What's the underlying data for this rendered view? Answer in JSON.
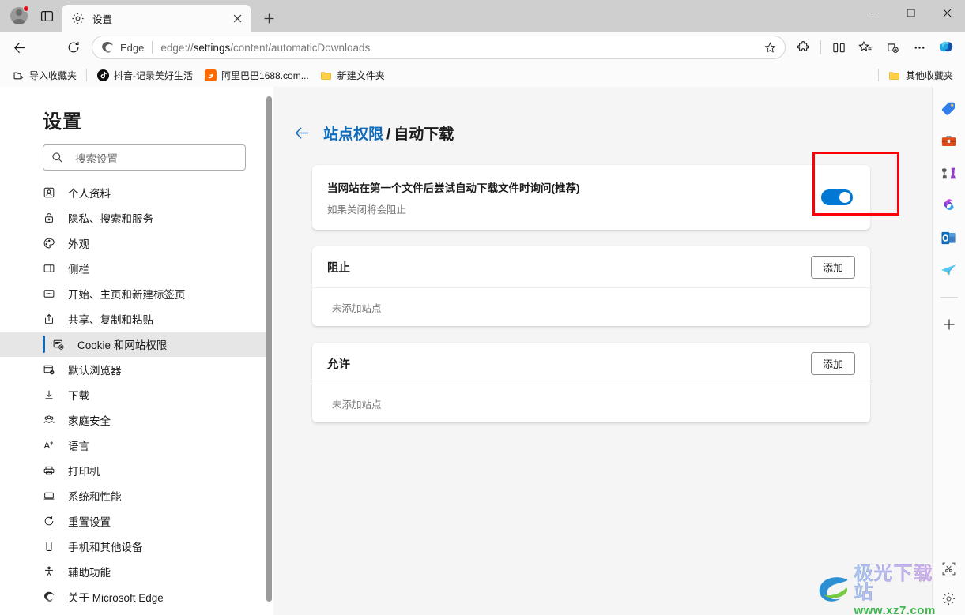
{
  "window": {
    "minimize_label": "—",
    "maximize_label": "□",
    "close_label": "✕"
  },
  "tabstrip": {
    "profile_name": "profile-avatar",
    "tab_actions_label": "tab-actions",
    "active_tab_title": "设置",
    "close_tab_label": "✕",
    "new_tab_label": "+"
  },
  "navbar": {
    "back_label": "←",
    "refresh_label": "⟳",
    "edge_chip_label": "Edge",
    "url_prefix": "edge://",
    "url_bold": "settings",
    "url_suffix": "/content/automaticDownloads",
    "url_full": "edge://settings/content/automaticDownloads",
    "favorite_label": "☆",
    "icons": [
      {
        "name": "extensions-icon",
        "title": "扩展"
      },
      {
        "name": "split-screen-icon",
        "title": "拆分屏幕"
      },
      {
        "name": "favorites-icon",
        "title": "收藏夹"
      },
      {
        "name": "collections-icon",
        "title": "集锦"
      },
      {
        "name": "settings-more-icon",
        "title": "设置及其他"
      },
      {
        "name": "copilot-icon",
        "title": "Copilot"
      }
    ]
  },
  "bookmarks": {
    "items": [
      {
        "label": "导入收藏夹",
        "icon": "import-favorites-icon"
      },
      {
        "label": "抖音-记录美好生活",
        "icon": "douyin-icon"
      },
      {
        "label": "阿里巴巴1688.com...",
        "icon": "alibaba-icon"
      },
      {
        "label": "新建文件夹",
        "icon": "folder-icon"
      }
    ],
    "other_favorites": {
      "label": "其他收藏夹",
      "icon": "folder-icon"
    }
  },
  "settings_nav": {
    "title": "设置",
    "search_placeholder": "搜索设置",
    "items": [
      {
        "label": "个人资料",
        "icon": "profile-icon",
        "active": false
      },
      {
        "label": "隐私、搜索和服务",
        "icon": "lock-icon",
        "active": false
      },
      {
        "label": "外观",
        "icon": "palette-icon",
        "active": false
      },
      {
        "label": "侧栏",
        "icon": "sidebar-icon",
        "active": false
      },
      {
        "label": "开始、主页和新建标签页",
        "icon": "home-icon",
        "active": false
      },
      {
        "label": "共享、复制和粘贴",
        "icon": "share-icon",
        "active": false
      },
      {
        "label": "Cookie 和网站权限",
        "icon": "cookie-icon",
        "active": true
      },
      {
        "label": "默认浏览器",
        "icon": "default-browser-icon",
        "active": false
      },
      {
        "label": "下载",
        "icon": "download-icon",
        "active": false
      },
      {
        "label": "家庭安全",
        "icon": "family-icon",
        "active": false
      },
      {
        "label": "语言",
        "icon": "language-icon",
        "active": false
      },
      {
        "label": "打印机",
        "icon": "printer-icon",
        "active": false
      },
      {
        "label": "系统和性能",
        "icon": "system-icon",
        "active": false
      },
      {
        "label": "重置设置",
        "icon": "reset-icon",
        "active": false
      },
      {
        "label": "手机和其他设备",
        "icon": "phone-icon",
        "active": false
      },
      {
        "label": "辅助功能",
        "icon": "accessibility-icon",
        "active": false
      },
      {
        "label": "关于 Microsoft Edge",
        "icon": "edge-icon",
        "active": false
      }
    ]
  },
  "content": {
    "breadcrumb": {
      "back_label": "←",
      "parent": "站点权限",
      "separator": "/",
      "current": "自动下载"
    },
    "toggle_card": {
      "title": "当网站在第一个文件后尝试自动下载文件时询问(推荐)",
      "subtitle": "如果关闭将会阻止",
      "toggle_on": true,
      "toggle_color": "#0078d4"
    },
    "sections": [
      {
        "title": "阻止",
        "add_label": "添加",
        "empty_text": "未添加站点"
      },
      {
        "title": "允许",
        "add_label": "添加",
        "empty_text": "未添加站点"
      }
    ],
    "annotation": {
      "color": "#fb0007"
    }
  },
  "edgebar": {
    "icons": [
      {
        "name": "tag-icon"
      },
      {
        "name": "toolbox-icon"
      },
      {
        "name": "games-icon"
      },
      {
        "name": "microsoft365-icon"
      },
      {
        "name": "outlook-icon"
      },
      {
        "name": "paper-plane-icon"
      }
    ],
    "add_label": "+",
    "bottom_icons": [
      {
        "name": "snip-icon"
      },
      {
        "name": "settings-gear-icon"
      }
    ]
  },
  "watermark": {
    "main": "极光下载站",
    "sub": "www.xz7.com"
  }
}
